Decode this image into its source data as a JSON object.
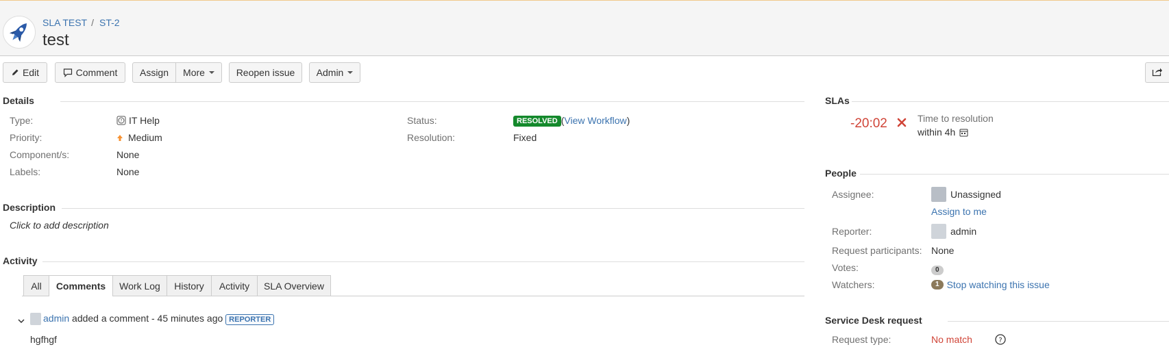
{
  "header": {
    "breadcrumb": [
      {
        "label": "SLA TEST"
      },
      {
        "label": "ST-2"
      }
    ],
    "breadcrumb_separator": "/",
    "title": "test"
  },
  "toolbar": {
    "edit_label": "Edit",
    "comment_label": "Comment",
    "assign_label": "Assign",
    "more_label": "More",
    "reopen_label": "Reopen issue",
    "admin_label": "Admin"
  },
  "details": {
    "title": "Details",
    "type_label": "Type:",
    "type_value": "IT Help",
    "priority_label": "Priority:",
    "priority_value": "Medium",
    "components_label": "Component/s:",
    "components_value": "None",
    "labels_label": "Labels:",
    "labels_value": "None",
    "status_label": "Status:",
    "status_value": "RESOLVED",
    "view_workflow": "View Workflow",
    "resolution_label": "Resolution:",
    "resolution_value": "Fixed"
  },
  "description": {
    "title": "Description",
    "placeholder": "Click to add description"
  },
  "activity": {
    "title": "Activity",
    "tabs": [
      {
        "label": "All"
      },
      {
        "label": "Comments"
      },
      {
        "label": "Work Log"
      },
      {
        "label": "History"
      },
      {
        "label": "Activity"
      },
      {
        "label": "SLA Overview"
      }
    ],
    "active_tab": "Comments",
    "comment": {
      "author": "admin",
      "action": "added a comment - 45 minutes ago",
      "tag": "REPORTER",
      "body": "hgfhgf"
    }
  },
  "slas": {
    "title": "SLAs",
    "time": "-20:02",
    "name": "Time to resolution",
    "target": "within 4h"
  },
  "people": {
    "title": "People",
    "assignee_label": "Assignee:",
    "assignee_value": "Unassigned",
    "assign_to_me": "Assign to me",
    "reporter_label": "Reporter:",
    "reporter_value": "admin",
    "participants_label": "Request participants:",
    "participants_value": "None",
    "votes_label": "Votes:",
    "votes_value": "0",
    "watchers_label": "Watchers:",
    "watchers_value": "1",
    "stop_watching": "Stop watching this issue"
  },
  "service_desk": {
    "title": "Service Desk request",
    "request_type_label": "Request type:",
    "request_type_value": "No match"
  },
  "colors": {
    "link": "#3b73af",
    "resolved": "#14892c",
    "sla_breached": "#d04437",
    "header_accent": "#f0c88a"
  }
}
